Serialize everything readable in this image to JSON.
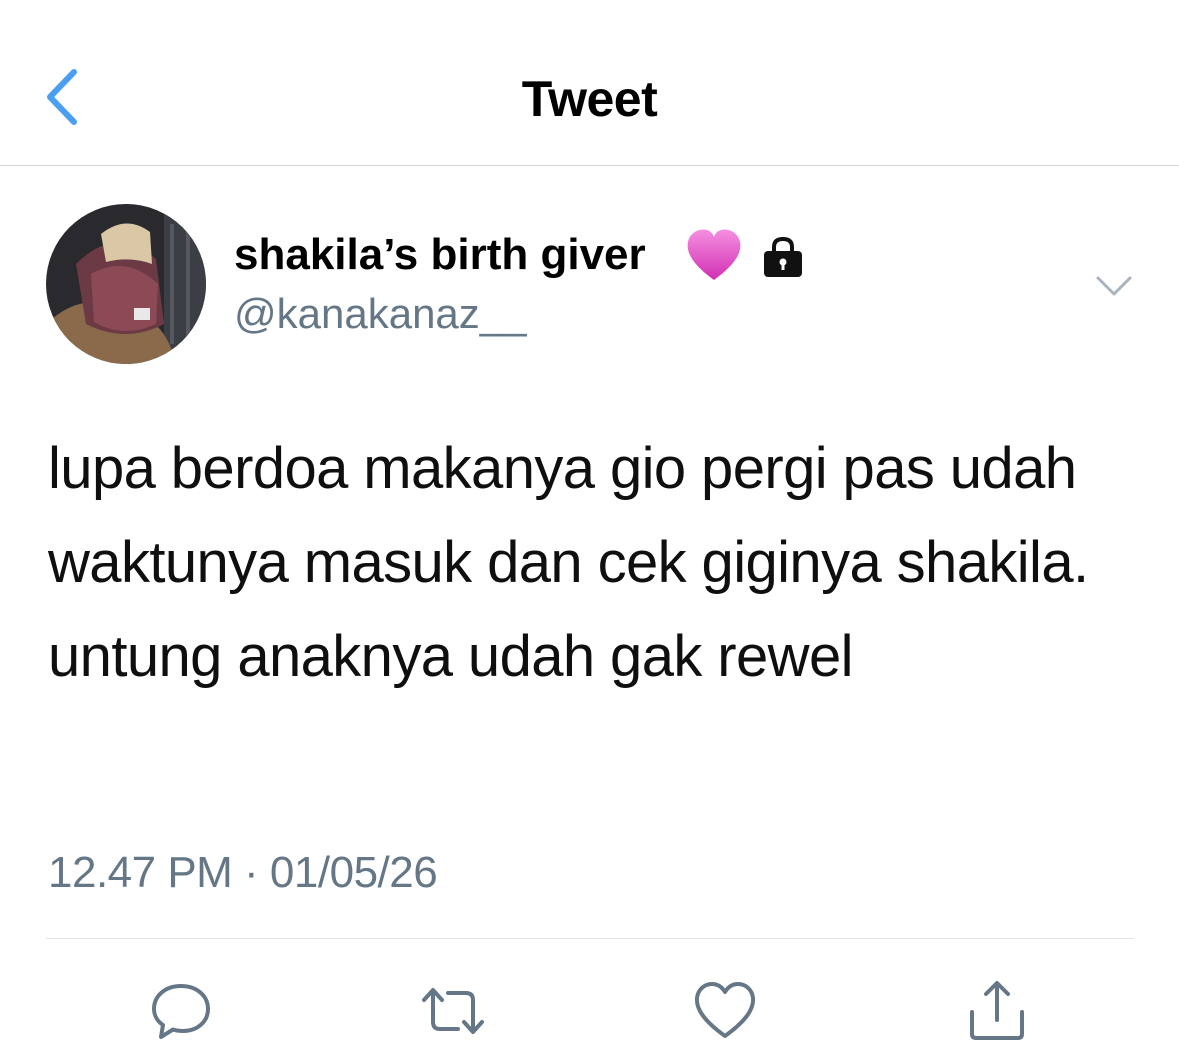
{
  "nav": {
    "title": "Tweet",
    "back_icon": "chevron-left-icon",
    "accent_color": "#4a9ff0"
  },
  "author": {
    "display_name": "shakila’s birth giver",
    "handle": "@kanakanaz__",
    "name_emoji": "pink-heart-icon",
    "protected_icon": "lock-icon"
  },
  "tweet": {
    "text": "lupa berdoa makanya gio pergi pas udah waktunya masuk dan cek giginya shakila. untung anaknya udah gak rewel",
    "timestamp": "12.47 PM · 01/05/26"
  },
  "actions": [
    {
      "icon": "reply-icon"
    },
    {
      "icon": "retweet-icon"
    },
    {
      "icon": "like-icon"
    },
    {
      "icon": "share-icon"
    }
  ],
  "colors": {
    "secondary_text": "#657786",
    "icon_gray": "#657786",
    "divider": "#e1e4e8"
  }
}
